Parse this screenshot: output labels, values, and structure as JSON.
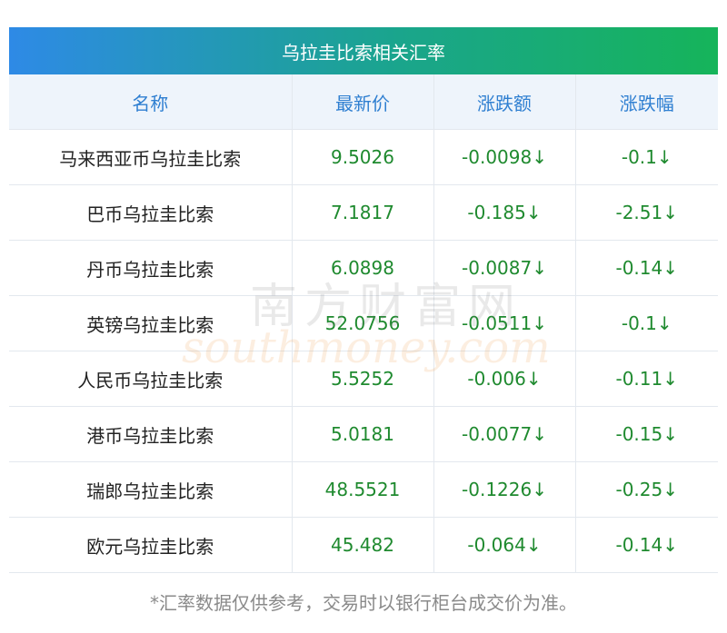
{
  "title": "乌拉圭比索相关汇率",
  "headers": [
    "名称",
    "最新价",
    "涨跌额",
    "涨跌幅"
  ],
  "rows": [
    {
      "name": "马来西亚币乌拉圭比索",
      "price": "9.5026",
      "change": "-0.0098↓",
      "pct": "-0.1↓"
    },
    {
      "name": "巴币乌拉圭比索",
      "price": "7.1817",
      "change": "-0.185↓",
      "pct": "-2.51↓"
    },
    {
      "name": "丹币乌拉圭比索",
      "price": "6.0898",
      "change": "-0.0087↓",
      "pct": "-0.14↓"
    },
    {
      "name": "英镑乌拉圭比索",
      "price": "52.0756",
      "change": "-0.0511↓",
      "pct": "-0.1↓"
    },
    {
      "name": "人民币乌拉圭比索",
      "price": "5.5252",
      "change": "-0.006↓",
      "pct": "-0.11↓"
    },
    {
      "name": "港币乌拉圭比索",
      "price": "5.0181",
      "change": "-0.0077↓",
      "pct": "-0.15↓"
    },
    {
      "name": "瑞郎乌拉圭比索",
      "price": "48.5521",
      "change": "-0.1226↓",
      "pct": "-0.25↓"
    },
    {
      "name": "欧元乌拉圭比索",
      "price": "45.482",
      "change": "-0.064↓",
      "pct": "-0.14↓"
    }
  ],
  "footnote": "*汇率数据仅供参考，交易时以银行柜台成交价为准。",
  "watermark": {
    "cn": "南方财富网",
    "en": "southmoney.com"
  },
  "colors": {
    "title_gradient_start": "#2e8ae6",
    "title_gradient_end": "#16b45a",
    "header_text": "#2f7fd1",
    "header_bg": "#eef4fb",
    "value_green": "#1f8a2f"
  }
}
